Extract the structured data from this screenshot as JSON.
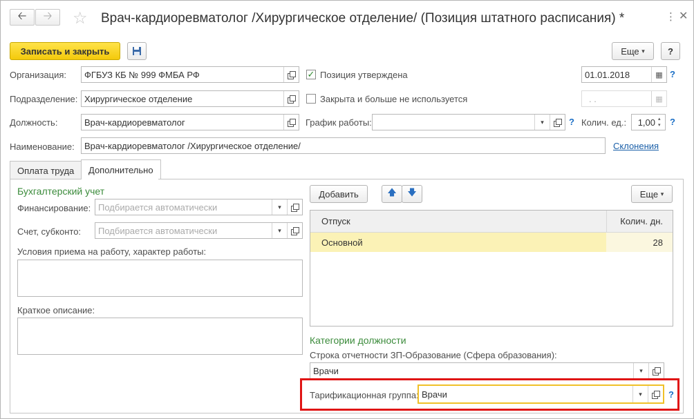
{
  "window": {
    "title": "Врач-кардиоревматолог /Хирургическое отделение/ (Позиция штатного расписания) *"
  },
  "toolbar": {
    "save_close": "Записать и закрыть",
    "more": "Еще",
    "help": "?"
  },
  "form": {
    "org_label": "Организация:",
    "org_value": "ФГБУЗ КБ № 999 ФМБА РФ",
    "approved_label": "Позиция утверждена",
    "approved_checked": true,
    "date_value": "01.01.2018",
    "dept_label": "Подразделение:",
    "dept_value": "Хирургическое отделение",
    "closed_label": "Закрыта и больше не используется",
    "closed_checked": false,
    "closed_date": " .  .",
    "position_label": "Должность:",
    "position_value": "Врач-кардиоревматолог",
    "schedule_label": "График работы:",
    "schedule_value": "",
    "units_label": "Колич. ед.:",
    "units_value": "1,00",
    "name_label": "Наименование:",
    "name_value": "Врач-кардиоревматолог /Хирургическое отделение/",
    "declension_link": "Склонения"
  },
  "tabs": [
    {
      "label": "Оплата труда",
      "active": false
    },
    {
      "label": "Дополнительно",
      "active": true
    }
  ],
  "accounting": {
    "heading": "Бухгалтерский учет",
    "financing_label": "Финансирование:",
    "financing_placeholder": "Подбирается автоматически",
    "account_label": "Счет, субконто:",
    "account_placeholder": "Подбирается автоматически",
    "conditions_label": "Условия приема на работу, характер работы:",
    "short_desc_label": "Краткое описание:"
  },
  "vacation": {
    "add_label": "Добавить",
    "more_label": "Еще",
    "columns": [
      "Отпуск",
      "Колич. дн."
    ],
    "rows": [
      {
        "name": "Основной",
        "days": "28"
      }
    ]
  },
  "categories": {
    "heading": "Категории должности",
    "report_label": "Строка отчетности ЗП-Образование (Сфера образования):",
    "report_value": "Врачи",
    "tariff_label": "Тарификационная группа:",
    "tariff_value": "Врачи"
  },
  "colors": {
    "accent_yellow": "#f4c90b",
    "selected_row": "#fbf2b6",
    "highlight_frame": "#e01515",
    "heading_green": "#3b8b3b"
  }
}
